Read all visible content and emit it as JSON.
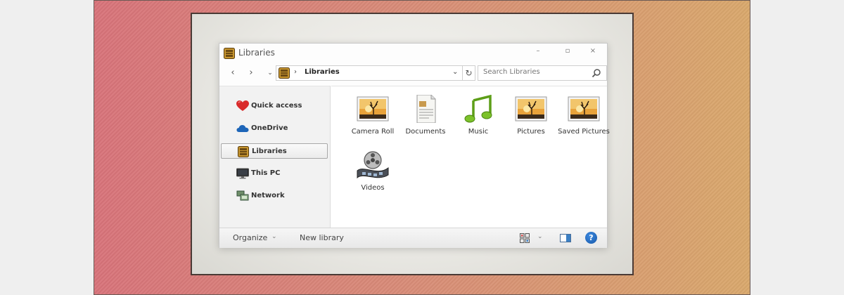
{
  "window": {
    "title": "Libraries",
    "controls": {
      "minimize": "–",
      "maximize": "▫",
      "close": "×"
    }
  },
  "nav": {
    "back": "‹",
    "forward": "›",
    "recent": "⌄",
    "address": {
      "separator": "›",
      "crumb": "Libraries",
      "dropdown": "⌄"
    },
    "refresh": "↻",
    "search": {
      "placeholder": "Search Libraries"
    }
  },
  "sidebar": {
    "items": [
      {
        "label": "Quick access",
        "icon": "heart-icon"
      },
      {
        "label": "OneDrive",
        "icon": "cloud-icon"
      },
      {
        "label": "Libraries",
        "icon": "library-icon",
        "selected": true
      },
      {
        "label": "This PC",
        "icon": "monitor-icon"
      },
      {
        "label": "Network",
        "icon": "network-icon"
      }
    ]
  },
  "libraries": [
    {
      "label": "Camera Roll",
      "icon": "picture-icon"
    },
    {
      "label": "Documents",
      "icon": "document-icon"
    },
    {
      "label": "Music",
      "icon": "music-note-icon"
    },
    {
      "label": "Pictures",
      "icon": "picture-icon"
    },
    {
      "label": "Saved Pictures",
      "icon": "picture-icon"
    },
    {
      "label": "Videos",
      "icon": "film-reel-icon"
    }
  ],
  "toolbar": {
    "organize": "Organize",
    "organize_chevron": "⌄",
    "new_library": "New library",
    "view_chevron": "⌄",
    "help": "?"
  },
  "colors": {
    "accent_blue": "#1d65b8",
    "library_gold": "#b98a2c",
    "heart_red": "#d92b2b",
    "music_green": "#6ab41e"
  }
}
